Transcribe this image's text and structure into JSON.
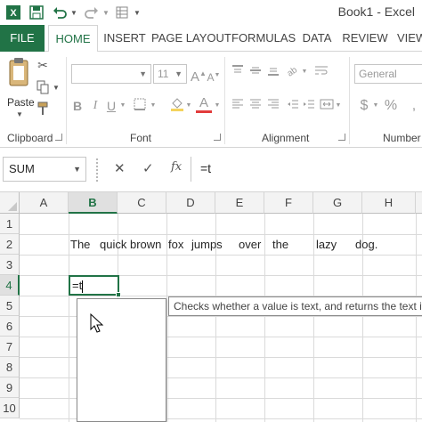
{
  "window": {
    "title": "Book1 - Excel"
  },
  "quick_access": [
    "excel-logo-icon",
    "save-icon",
    "undo-icon",
    "redo-icon",
    "customize-icon"
  ],
  "ribbon_tabs": [
    "FILE",
    "HOME",
    "INSERT",
    "PAGE LAYOUT",
    "FORMULAS",
    "DATA",
    "REVIEW",
    "VIEW"
  ],
  "active_tab": "HOME",
  "ribbon": {
    "clipboard": {
      "label": "Clipboard",
      "paste_label": "Paste"
    },
    "font": {
      "label": "Font",
      "font_size": "11",
      "bold": "B",
      "italic": "I",
      "underline": "U"
    },
    "alignment": {
      "label": "Alignment"
    },
    "number": {
      "label": "Number",
      "format": "General",
      "currency": "$",
      "percent": "%"
    }
  },
  "formula_bar": {
    "name_box": "SUM",
    "cancel": "✕",
    "enter": "✓",
    "fx": "fx",
    "value": "=t"
  },
  "columns": [
    "A",
    "B",
    "C",
    "D",
    "E",
    "F",
    "G",
    "H"
  ],
  "active_column": "B",
  "rows": [
    "1",
    "2",
    "3",
    "4",
    "5",
    "6",
    "7",
    "8",
    "9",
    "10"
  ],
  "active_row": "4",
  "row2_words": [
    "The",
    "quick brown",
    "fox",
    "jumps",
    "over",
    "the",
    "lazy",
    "dog."
  ],
  "active_cell": {
    "ref": "B4",
    "value": "=t"
  },
  "autocomplete": {
    "tooltip": "Checks whether a value is text, and returns the text if it is, or r",
    "items": []
  },
  "colors": {
    "accent": "#217346",
    "grid": "#dadada",
    "header_bg": "#f3f3f3"
  }
}
